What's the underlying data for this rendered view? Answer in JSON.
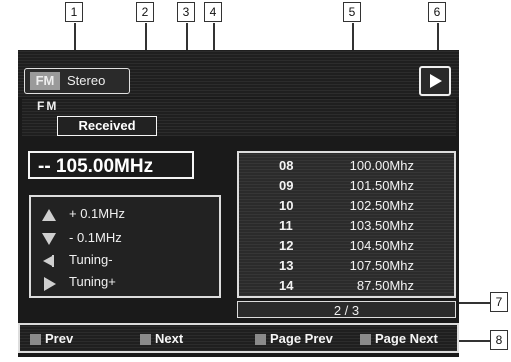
{
  "callouts": [
    "1",
    "2",
    "3",
    "4",
    "5",
    "6",
    "7",
    "8"
  ],
  "header": {
    "band": "FM",
    "mode": "Stereo"
  },
  "info": {
    "band_label": "FM",
    "status": "Received"
  },
  "frequency": "-- 105.00MHz",
  "tuning": [
    {
      "icon": "triangle-up-icon",
      "label": "+ 0.1MHz"
    },
    {
      "icon": "triangle-down-icon",
      "label": "- 0.1MHz"
    },
    {
      "icon": "seek-left-icon",
      "label": "Tuning-"
    },
    {
      "icon": "play-right-icon",
      "label": "Tuning+"
    }
  ],
  "presets": [
    {
      "num": "08",
      "freq": "100.00Mhz"
    },
    {
      "num": "09",
      "freq": "101.50Mhz"
    },
    {
      "num": "10",
      "freq": "102.50Mhz"
    },
    {
      "num": "11",
      "freq": "103.50Mhz"
    },
    {
      "num": "12",
      "freq": "104.50Mhz"
    },
    {
      "num": "13",
      "freq": "107.50Mhz"
    },
    {
      "num": "14",
      "freq": "87.50Mhz"
    }
  ],
  "page_indicator": "2 / 3",
  "bottom_buttons": [
    "Prev",
    "Next",
    "Page Prev",
    "Page Next"
  ]
}
